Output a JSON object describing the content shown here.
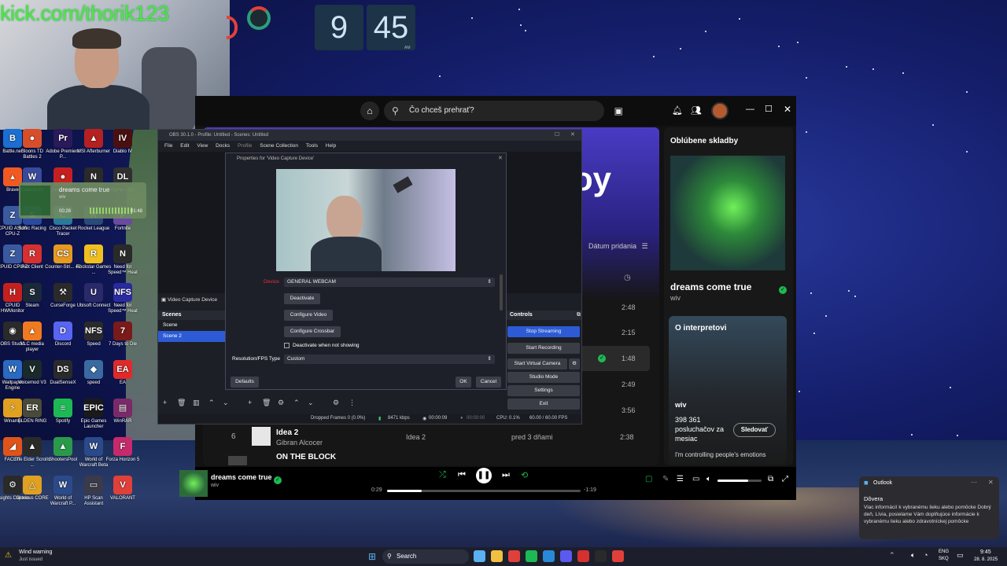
{
  "overlay": {
    "stream_url": "kick.com/thorik123"
  },
  "clock": {
    "hour": "9",
    "minute": "45",
    "ampm": "AM"
  },
  "desktop_icons": [
    {
      "label": "Battle.net",
      "color": "#1b6fd1",
      "glyph": "B"
    },
    {
      "label": "Bloons TD Battles 2",
      "color": "#d64f2a",
      "glyph": "●"
    },
    {
      "label": "Adobe Premiere P...",
      "color": "#2a1a5a",
      "glyph": "Pr"
    },
    {
      "label": "MSI Afterburner",
      "color": "#b52020",
      "glyph": "▲"
    },
    {
      "label": "Diablo IV",
      "color": "#4a1010",
      "glyph": "IV"
    },
    {
      "label": "Brave",
      "color": "#f05a22",
      "glyph": "▴"
    },
    {
      "label": "Cataclysm",
      "color": "#3a4a9a",
      "glyph": "W"
    },
    {
      "label": "Among Us",
      "color": "#c52020",
      "glyph": "●"
    },
    {
      "label": "NFS",
      "color": "#2a2a2a",
      "glyph": "N"
    },
    {
      "label": "Dying Light",
      "color": "#303030",
      "glyph": "DL"
    },
    {
      "label": "CPUID ASUS CPU-Z",
      "color": "#3a5aa0",
      "glyph": "Z"
    },
    {
      "label": "Sonic Racing",
      "color": "#2a4aa0",
      "glyph": "S"
    },
    {
      "label": "Cisco Packet Tracer",
      "color": "#2a7a9a",
      "glyph": "C"
    },
    {
      "label": "Rocket League",
      "color": "#2a4a7a",
      "glyph": "R"
    },
    {
      "label": "Fortnite",
      "color": "#6a4aa0",
      "glyph": "F"
    },
    {
      "label": "CPUID CPU-Z",
      "color": "#3a5aa0",
      "glyph": "Z"
    },
    {
      "label": "Riot Client",
      "color": "#d63030",
      "glyph": "R"
    },
    {
      "label": "Counter-Stri... e2",
      "color": "#e69a20",
      "glyph": "CS"
    },
    {
      "label": "Rockstar Games ...",
      "color": "#f0c020",
      "glyph": "R"
    },
    {
      "label": "Need for Speed™ Heat",
      "color": "#2a2a2a",
      "glyph": "N"
    },
    {
      "label": "CPUID HWMonitor",
      "color": "#c52020",
      "glyph": "H"
    },
    {
      "label": "Steam",
      "color": "#1b2838",
      "glyph": "S"
    },
    {
      "label": "CurseForge",
      "color": "#2a2a2a",
      "glyph": "⚒"
    },
    {
      "label": "Ubisoft Connect",
      "color": "#2a2a6a",
      "glyph": "U"
    },
    {
      "label": "Need for Speed™ Heat",
      "color": "#2a2aa0",
      "glyph": "NFS"
    },
    {
      "label": "OBS Studio",
      "color": "#2a2a2a",
      "glyph": "◉"
    },
    {
      "label": "VLC media player",
      "color": "#f07a20",
      "glyph": "▲"
    },
    {
      "label": "Discord",
      "color": "#5865f2",
      "glyph": "D"
    },
    {
      "label": "Speed",
      "color": "#2a2a2a",
      "glyph": "NFS"
    },
    {
      "label": "7 Days to Die",
      "color": "#7a1a1a",
      "glyph": "7"
    },
    {
      "label": "Wallpaper Engine",
      "color": "#2a6ac0",
      "glyph": "W"
    },
    {
      "label": "Voicemod V3",
      "color": "#1a2a2a",
      "glyph": "V"
    },
    {
      "label": "DualSenseX",
      "color": "#2a2a2a",
      "glyph": "DS"
    },
    {
      "label": "speed",
      "color": "#3a6aa0",
      "glyph": "◆"
    },
    {
      "label": "EA",
      "color": "#e02a2a",
      "glyph": "EA"
    },
    {
      "label": "Winamp",
      "color": "#e0a020",
      "glyph": "⚡"
    },
    {
      "label": "ELDEN RING",
      "color": "#4a4a3a",
      "glyph": "ER"
    },
    {
      "label": "Spotify",
      "color": "#1db954",
      "glyph": "≡"
    },
    {
      "label": "Epic Games Launcher",
      "color": "#1a1a1a",
      "glyph": "EPIC"
    },
    {
      "label": "WinRAR",
      "color": "#7a2a6a",
      "glyph": "▤"
    },
    {
      "label": "FACEIT",
      "color": "#e0541a",
      "glyph": "◢"
    },
    {
      "label": "The Elder Scrolls ...",
      "color": "#2a2a2a",
      "glyph": "▲"
    },
    {
      "label": "ShootersPool",
      "color": "#2a9a4a",
      "glyph": "▲"
    },
    {
      "label": "World of Warcraft Beta",
      "color": "#2a4a8a",
      "glyph": "W"
    },
    {
      "label": "Forza Horizon 5",
      "color": "#c52a6a",
      "glyph": "F"
    },
    {
      "label": "Insights Capture",
      "color": "#2a2a2a",
      "glyph": "⚙"
    },
    {
      "label": "Glorious CORE",
      "color": "#e0a020",
      "glyph": "△"
    },
    {
      "label": "World of Warcraft P...",
      "color": "#2a4a8a",
      "glyph": "W"
    },
    {
      "label": "HP Scan Assistant",
      "color": "#3a3a4a",
      "glyph": "▭"
    },
    {
      "label": "VALORANT",
      "color": "#e0403a",
      "glyph": "V"
    }
  ],
  "mini_widget": {
    "title": "dreams come true",
    "artist": "wiv",
    "elapsed": "00:28",
    "total": "01:48"
  },
  "spotify": {
    "search_placeholder": "Čo chceš prehrať?",
    "banner_text": "oy",
    "sort_label": "Dátum pridania",
    "durations": [
      "2:48",
      "2:15",
      "1:48",
      "2:49",
      "3:56"
    ],
    "row6": {
      "num": "6",
      "title": "Idea 2",
      "artist": "Gibran Alcocer",
      "album": "Idea 2",
      "added": "pred 3 dňami",
      "duration": "2:38"
    },
    "row7_title": "ON THE BLOCK",
    "right_panel": {
      "header": "Oblúbene skladby",
      "song_title": "dreams come true",
      "song_artist": "wiv",
      "about_header": "O interpretovi",
      "artist_name": "wiv",
      "listeners": "398 361 posluchačov za mesiac",
      "follow_label": "Sledovať",
      "bio": "I'm controlling people's emotions"
    },
    "player": {
      "title": "dreams come true",
      "artist": "wiv",
      "elapsed": "0:29",
      "remaining": "-1:19",
      "progress": 0.18,
      "volume": 0.7
    }
  },
  "obs": {
    "title": "OBS 30.1.0 - Profile: Untitled - Scenes: Untitled",
    "menu": [
      "File",
      "Edit",
      "View",
      "Docks",
      "Profile",
      "Scene Collection",
      "Tools",
      "Help"
    ],
    "source_label": "Video Capture Device",
    "scenes_header": "Scenes",
    "scenes": [
      "Scene",
      "Scene 2"
    ],
    "controls_header": "Controls",
    "controls": [
      "Stop Streaming",
      "Start Recording",
      "Start Virtual Camera",
      "Studio Mode",
      "Settings",
      "Exit"
    ],
    "status": {
      "dropped": "Dropped Frames 0 (0.0%)",
      "kbps": "8471 kbps",
      "live": "00:00:09",
      "rec": "00:00:00",
      "cpu": "CPU: 0.1%",
      "fps": "60.00 / 60.00 FPS"
    }
  },
  "properties": {
    "title": "Properties for 'Video Capture Device'",
    "device_label": "Device",
    "device_value": "GENERAL WEBCAM",
    "deactivate": "Deactivate",
    "configure_video": "Configure Video",
    "configure_crossbar": "Configure Crossbar",
    "deactivate_check": "Deactivate when not showing",
    "res_label": "Resolution/FPS Type",
    "res_value": "Custom",
    "defaults": "Defaults",
    "ok": "OK",
    "cancel": "Cancel"
  },
  "toast": {
    "app": "Outlook",
    "title": "Dôvera",
    "body": "Viac informácií k vybranému lieku alebo pomôcke Dobrý deň, Lívia, posielame Vám doplňujúce informácie k vybranému lieku alebo zdravotníckej pomôcke"
  },
  "taskbar": {
    "weather_title": "Wind warning",
    "weather_sub": "Just issued",
    "search": "Search",
    "lang1": "ENG",
    "lang2": "SKQ",
    "time": "9:45",
    "date": "28. 8. 2025"
  },
  "colors": {
    "spotify_green": "#1db954",
    "obs_blue": "#2d5bd6",
    "device_label_red": "#e0303a"
  }
}
